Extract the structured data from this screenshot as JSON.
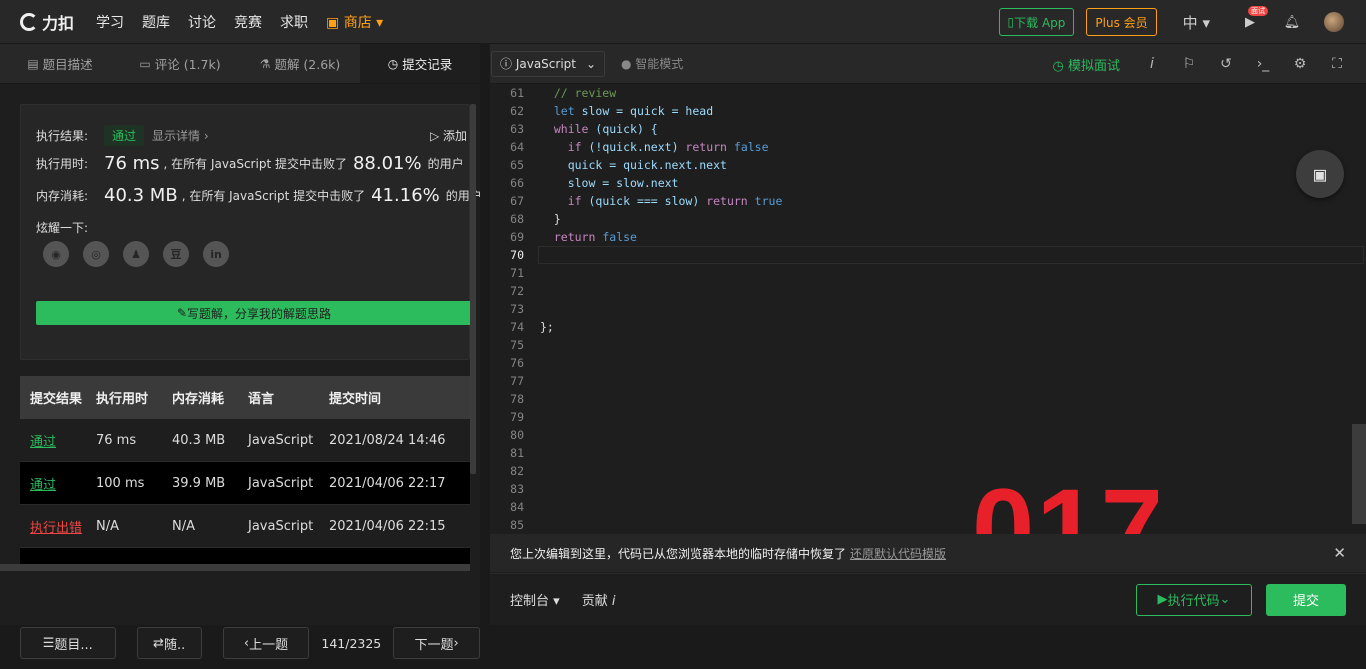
{
  "nav": {
    "logo": "力扣",
    "items": [
      "学习",
      "题库",
      "讨论",
      "竞赛",
      "求职"
    ],
    "store": "商店",
    "download_app": "下载 App",
    "plus": "Plus 会员",
    "lang": "中",
    "badge": "面试"
  },
  "tabs": [
    {
      "icon": "description-icon",
      "label": "题目描述"
    },
    {
      "icon": "comment-icon",
      "label": "评论 (1.7k)"
    },
    {
      "icon": "flask-icon",
      "label": "题解 (2.6k)"
    },
    {
      "icon": "clock-icon",
      "label": "提交记录"
    }
  ],
  "result": {
    "label_result": "执行结果:",
    "status": "通过",
    "detail": "显示详情 ›",
    "add_note": "添加",
    "label_time": "执行用时:",
    "time_value": "76 ms",
    "time_text": ", 在所有 JavaScript 提交中击败了",
    "time_pct": "88.01%",
    "users": "的用户",
    "label_mem": "内存消耗:",
    "mem_value": "40.3 MB",
    "mem_text": ", 在所有 JavaScript 提交中击败了",
    "mem_pct": "41.16%",
    "share_label": "炫耀一下:",
    "share_icons": [
      "wechat-icon",
      "weibo-icon",
      "qq-icon",
      "douban-icon",
      "linkedin-icon"
    ],
    "write_solution": "写题解，分享我的解题思路"
  },
  "table": {
    "headers": [
      "提交结果",
      "执行用时",
      "内存消耗",
      "语言",
      "提交时间"
    ],
    "rows": [
      {
        "status": "通过",
        "time": "76 ms",
        "mem": "40.3 MB",
        "lang": "JavaScript",
        "date": "2021/08/24 14:46"
      },
      {
        "status": "通过",
        "time": "100 ms",
        "mem": "39.9 MB",
        "lang": "JavaScript",
        "date": "2021/04/06 22:17"
      },
      {
        "status": "执行出错",
        "time": "N/A",
        "mem": "N/A",
        "lang": "JavaScript",
        "date": "2021/04/06 22:15"
      }
    ]
  },
  "bottom_left": {
    "list_btn": "题目...",
    "random_btn": "随..",
    "prev_btn": "上一题",
    "page": "141/2325",
    "next_btn": "下一题"
  },
  "editor": {
    "language": "JavaScript",
    "smart_mode": "智能模式",
    "mock_interview": "模拟面试",
    "line_numbers": [
      "61",
      "62",
      "63",
      "64",
      "65",
      "66",
      "67",
      "68",
      "69",
      "70",
      "71",
      "72",
      "73",
      "74",
      "75",
      "76",
      "77",
      "78",
      "79",
      "80",
      "81",
      "82",
      "83",
      "84",
      "85"
    ],
    "current_line": "70",
    "stamp": "017"
  },
  "notice": {
    "message": "您上次编辑到这里，代码已从您浏览器本地的临时存储中恢复了",
    "restore_link": "还原默认代码模版"
  },
  "bottom_right": {
    "console": "控制台",
    "contribute": "贡献",
    "run": "执行代码",
    "submit": "提交"
  },
  "colors": {
    "accent": "#2cbb5d",
    "orange": "#ffa116",
    "error": "#ef4743"
  }
}
